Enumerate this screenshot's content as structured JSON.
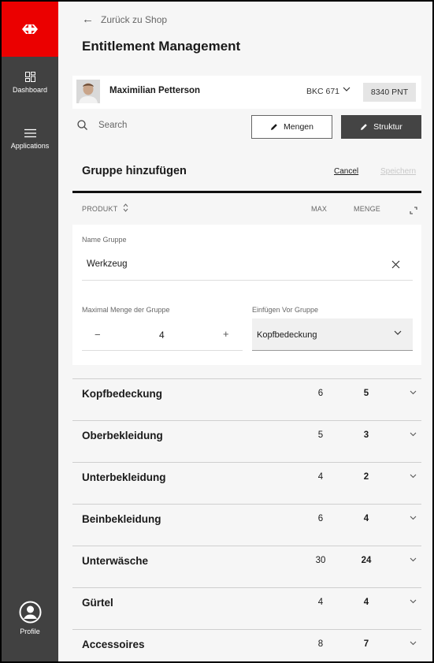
{
  "colors": {
    "brand_red": "#eb0000",
    "sidebar_bg": "#414141",
    "primary_button": "#444444"
  },
  "sidebar": {
    "items": [
      {
        "label": "Dashboard",
        "icon": "dashboard-icon"
      },
      {
        "label": "Applications",
        "icon": "menu-icon"
      }
    ],
    "profile_label": "Profile"
  },
  "header": {
    "back_label": "Zurück zu Shop",
    "title": "Entitlement Management"
  },
  "user": {
    "name": "Maximilian Petterson",
    "account": "BKC 671",
    "points": "8340 PNT"
  },
  "toolbar": {
    "search_placeholder": "Search",
    "mengen_label": "Mengen",
    "struktur_label": "Struktur"
  },
  "add_group": {
    "title": "Gruppe hinzufügen",
    "cancel_label": "Cancel",
    "save_label": "Speichern"
  },
  "columns": {
    "produkt": "PRODUKT",
    "max": "MAX",
    "menge": "MENGE"
  },
  "form": {
    "name_label": "Name Gruppe",
    "name_value": "Werkzeug",
    "max_label": "Maximal Menge der Gruppe",
    "max_value": "4",
    "minus": "−",
    "plus": "+",
    "insert_label": "Einfügen Vor Gruppe",
    "insert_value": "Kopfbedeckung"
  },
  "groups": [
    {
      "name": "Kopfbedeckung",
      "max": "6",
      "menge": "5"
    },
    {
      "name": "Oberbekleidung",
      "max": "5",
      "menge": "3"
    },
    {
      "name": "Unterbekleidung",
      "max": "4",
      "menge": "2"
    },
    {
      "name": "Beinbekleidung",
      "max": "6",
      "menge": "4"
    },
    {
      "name": "Unterwäsche",
      "max": "30",
      "menge": "24"
    },
    {
      "name": "Gürtel",
      "max": "4",
      "menge": "4"
    },
    {
      "name": "Accessoires",
      "max": "8",
      "menge": "7"
    }
  ]
}
